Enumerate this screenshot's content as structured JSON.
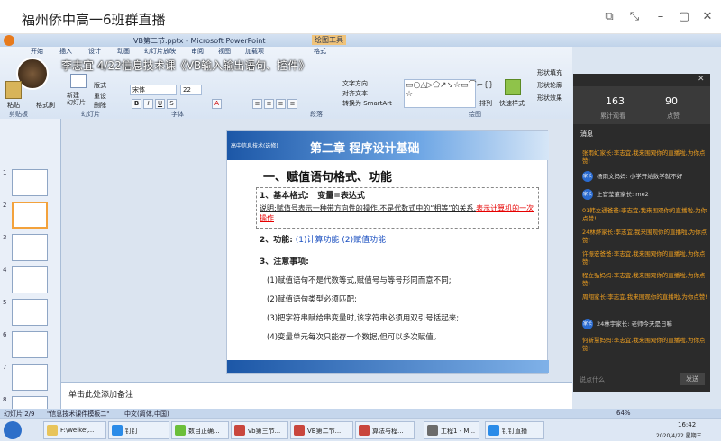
{
  "window": {
    "title": "福州侨中高一6班群直播"
  },
  "ppt": {
    "title": "VB第二节.pptx - Microsoft PowerPoint",
    "drawtools": "绘图工具",
    "tabs": [
      "开始",
      "插入",
      "设计",
      "动画",
      "幻灯片放映",
      "审阅",
      "视图",
      "加载项",
      "格式"
    ],
    "groups": [
      "剪贴板",
      "幻灯片",
      "字体",
      "段落",
      "绘图",
      "编辑"
    ],
    "font": "宋体",
    "size": "22",
    "btn": {
      "paste": "粘贴",
      "cut": "剪切",
      "copy": "复制",
      "format": "格式刷",
      "newslide": "新建\n幻灯片",
      "layout": "版式",
      "reset": "重设",
      "delete": "删除",
      "textdir": "文字方向",
      "align": "对齐文本",
      "smartart": "转换为 SmartArt",
      "arrange": "排列",
      "quick": "快速样式",
      "fill": "形状填充",
      "outline": "形状轮廓",
      "effect": "形状效果",
      "find": "查找",
      "replace": "替换",
      "select": "选择"
    }
  },
  "overlay": "李志宜 4/22信息技术课《VB输入输出语句、控件》",
  "slide": {
    "header": "高中信息技术(选修)",
    "title": "第二章 程序设计基础",
    "h1": "一、赋值语句格式、功能",
    "l1a": "1、基本格式:",
    "l1b": "变量=表达式",
    "note1": "说明:赋值号表示一种带方向性的操作,不是代数式中的“相等”的关系,",
    "note2": "表示计算机的一次操作",
    "l2a": "2、功能:",
    "l2b": "(1)计算功能 (2)赋值功能",
    "l3": "3、注意事项:",
    "p1": "(1)赋值语句不是代数等式,赋值号与等号形同而意不同;",
    "p2": "(2)赋值语句类型必须匹配;",
    "p3": "(3)把字符串赋给串变量时,该字符串必须用双引号括起来;",
    "p4": "(4)变量单元每次只能存一个数据,但可以多次赋值。"
  },
  "notes": "单击此处添加备注",
  "status": {
    "slide": "幻灯片 2/9",
    "theme": "\"信息技术课件模板二\"",
    "lang": "中文(简体,中国)",
    "zoom": "64%"
  },
  "panel": {
    "watch": "163",
    "watch_l": "累计观看",
    "like": "90",
    "like_l": "点赞",
    "title": "消息",
    "input": "说点什么",
    "send": "发送",
    "msgs": [
      "张雨虹家长:李志宜,我来围观你的直播啦,为你点赞!",
      "杨雨文妈妈: 小学开始数学就不好",
      "上官莹董家长: me2",
      "01韩立通爸爸:李志宜,我来围观你的直播啦,为你点赞!",
      "24林烨家长:李志宜,我来围观你的直播啦,为你点赞!",
      "许振宏爸爸:李志宜,我来围观你的直播啦,为你点赞!",
      "程立弘妈妈:李志宜,我来围观你的直播啦,为你点赞!",
      "周翔家长:李志宜,我来围观你的直播啦,为你点赞!",
      "24林宇家长: 老师今天是日嘛",
      "何新慧妈妈:李志宜,我来围观你的直播啦,为你点赞!"
    ]
  },
  "taskbar": {
    "items": [
      "F:\\weike\\...",
      "钉钉",
      "数目正确...",
      "vb第三节...",
      "VB第二节...",
      "算法与程...",
      "工程1 - M...",
      "钉钉直播"
    ],
    "time": "16:42",
    "date": "2020/4/22 星期三"
  },
  "colors": {
    "title_blue": "#1c57a7",
    "accent_red": "#e60000",
    "func_blue": "#1a4fc0",
    "msg_orange": "#f0a020"
  }
}
